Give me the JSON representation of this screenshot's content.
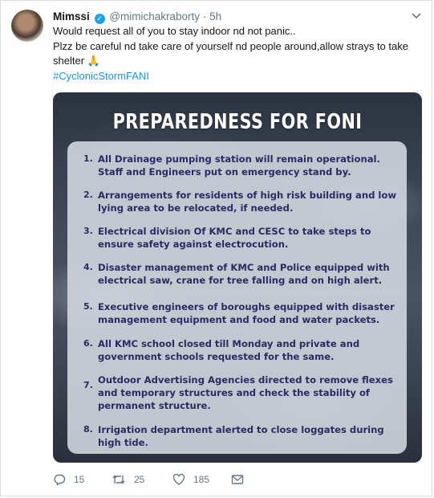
{
  "tweet": {
    "author_name": "Mimssi",
    "handle": "@mimichakraborty",
    "separator": "·",
    "time": "5h",
    "lines": [
      "Would request all of you to stay indoor nd not panic..",
      "Plzz be careful nd take care of yourself nd people around,allow strays to take shelter"
    ],
    "emoji": "🙏",
    "hashtag": "#CyclonicStormFANI"
  },
  "image": {
    "title": "PREPAREDNESS FOR FONI",
    "items": [
      {
        "num": "1.",
        "text": "All Drainage pumping station will remain operational. Staff and Engineers put on emergency stand by."
      },
      {
        "num": "2.",
        "text": "Arrangements for residents of high risk building  and low lying area to be relocated, if needed."
      },
      {
        "num": "3.",
        "text": "Electrical division Of KMC and CESC to take steps to ensure safety against electrocution."
      },
      {
        "num": "4.",
        "text": "Disaster management of KMC and Police equipped with electrical saw, crane for tree falling and on high alert."
      },
      {
        "num": "5.",
        "text": "Executive engineers of boroughs equipped with disaster management equipment and food and water packets."
      },
      {
        "num": "6.",
        "text": "All KMC school closed till Monday and private and government schools requested for the same."
      },
      {
        "num": "7.",
        "text": "Outdoor Advertising Agencies directed to remove flexes and temporary structures and check the stability of permanent structure."
      },
      {
        "num": "8.",
        "text": "Irrigation department alerted to close loggates during high tide."
      }
    ]
  },
  "actions": {
    "reply_count": "15",
    "retweet_count": "25",
    "like_count": "185",
    "icons": [
      "reply-icon",
      "retweet-icon",
      "like-icon",
      "dm-icon"
    ]
  },
  "colors": {
    "link": "#1b95e0",
    "verified": "#1da1f2",
    "muted": "#657786",
    "list_text": "#2b2a62"
  }
}
